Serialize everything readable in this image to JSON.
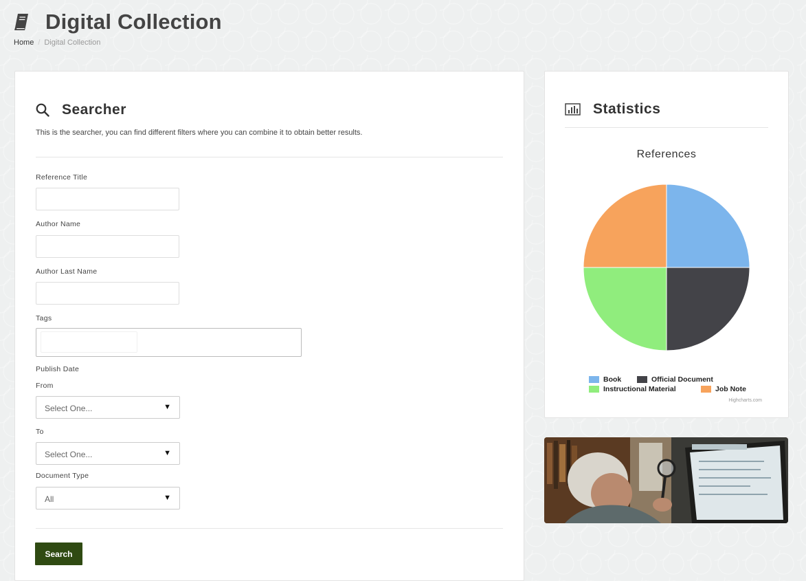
{
  "header": {
    "title": "Digital Collection",
    "breadcrumb": {
      "home": "Home",
      "current": "Digital Collection"
    }
  },
  "searcher": {
    "title": "Searcher",
    "description": "This is the searcher, you can find different filters where you can combine it to obtain better results.",
    "fields": {
      "reference_title": {
        "label": "Reference Title",
        "value": ""
      },
      "author_name": {
        "label": "Author Name",
        "value": ""
      },
      "author_last_name": {
        "label": "Author Last Name",
        "value": ""
      },
      "tags": {
        "label": "Tags"
      }
    },
    "publish_date": {
      "label": "Publish Date",
      "from_label": "From",
      "from_value": "Select One...",
      "to_label": "To",
      "to_value": "Select One..."
    },
    "document_type": {
      "label": "Document Type",
      "value": "All"
    },
    "search_button": "Search"
  },
  "statistics": {
    "title": "Statistics",
    "credits": "Highcharts.com"
  },
  "chart_data": {
    "type": "pie",
    "title": "References",
    "labels": [
      "Book",
      "Official Document",
      "Instructional Material",
      "Job Note"
    ],
    "values": [
      25,
      25,
      25,
      25
    ],
    "colors": [
      "#7cb5ec",
      "#434348",
      "#90ed7d",
      "#f7a35c"
    ],
    "legend_position": "bottom"
  },
  "colors": {
    "search_button": "#2f4a12"
  },
  "icons": {
    "header": "book-icon",
    "searcher": "search-icon",
    "statistics": "bar-chart-icon"
  }
}
